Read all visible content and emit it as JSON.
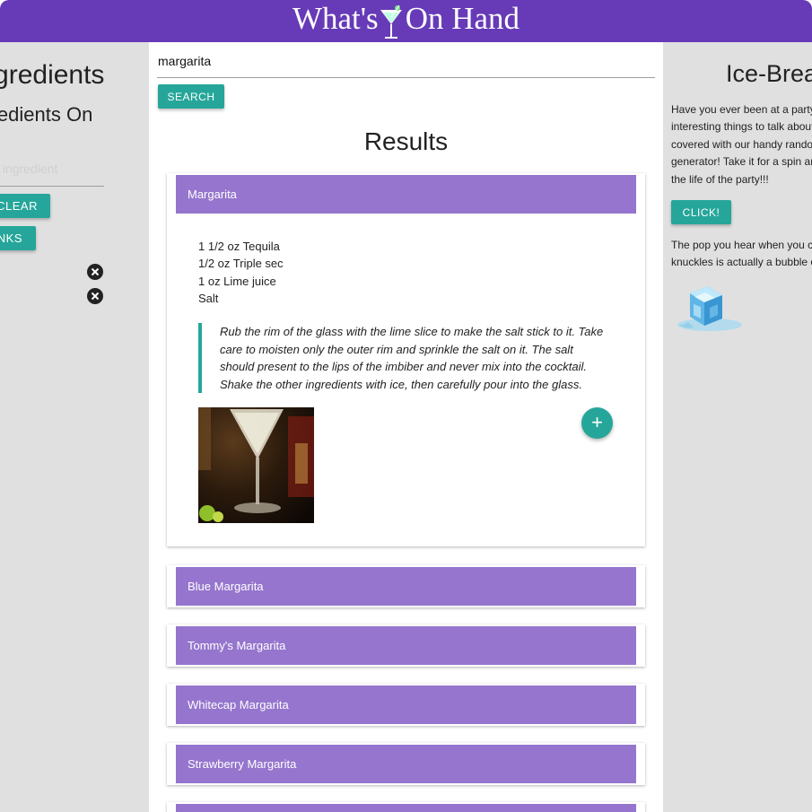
{
  "header": {
    "logo_left": "What's",
    "logo_right": "On Hand"
  },
  "left_panel": {
    "title": "Ingredients",
    "subtitle": "Ingredients On",
    "input_placeholder": "Add ingredient",
    "clear_label": "Clear",
    "drinks_label": "Drinks"
  },
  "search": {
    "value": "margarita",
    "button_label": "Search"
  },
  "results": {
    "title": "Results",
    "expanded": {
      "name": "Margarita",
      "ingredients": [
        "1 1/2 oz Tequila",
        "1/2 oz Triple sec",
        "1 oz Lime juice",
        "Salt"
      ],
      "instructions": [
        "Rub the rim of the glass with the lime slice to make the salt stick to it. Take",
        "care to moisten only the outer rim and sprinkle the salt on it. The salt",
        "should present to the lips of the imbiber and never mix into the cocktail.",
        "Shake the other ingredients with ice, then carefully pour into the glass."
      ],
      "add_label": "+"
    },
    "items": [
      "Blue Margarita",
      "Tommy's Margarita",
      "Whitecap Margarita",
      "Strawberry Margarita"
    ]
  },
  "right_panel": {
    "title": "Ice-Breakers",
    "intro_lines": [
      "Have you ever been at a party with no",
      "interesting things to talk about? We've got you",
      "covered with our handy random fact",
      "generator! Take it for a spin and become",
      "the life of the party!!!"
    ],
    "button_label": "Click!",
    "fact_lines": [
      "The pop you hear when you crack your",
      "knuckles is actually a bubble of gas bursting."
    ]
  },
  "colors": {
    "header": "#673ab7",
    "card_header": "#9575cd",
    "accent": "#26a69a",
    "side_panel": "#e0e0e0"
  }
}
